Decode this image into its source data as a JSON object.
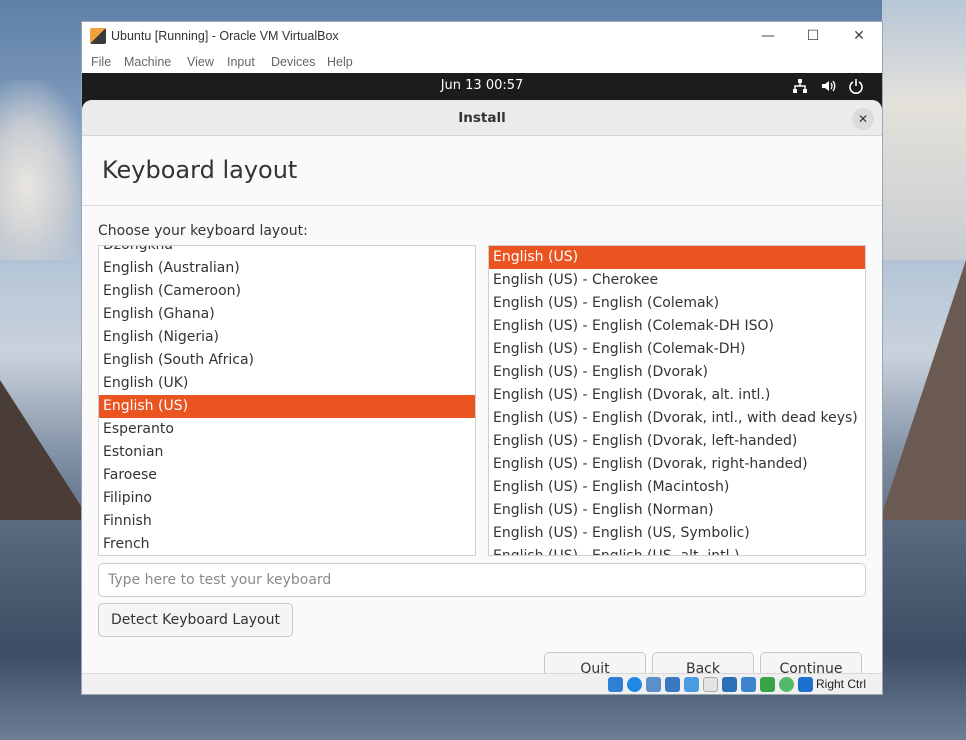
{
  "window": {
    "title": "Ubuntu [Running] - Oracle VM VirtualBox",
    "minimize": "—",
    "maximize": "☐",
    "close": "✕"
  },
  "menubar": [
    "File",
    "Machine",
    "View",
    "Input",
    "Devices",
    "Help"
  ],
  "topbar": {
    "clock": "Jun 13  00:57",
    "icons": [
      "network-icon",
      "volume-icon",
      "power-icon"
    ]
  },
  "dialog": {
    "title": "Install",
    "close": "✕",
    "heading": "Keyboard layout",
    "choose_label": "Choose your keyboard layout:",
    "accent_color": "#e95420"
  },
  "layouts": [
    "Dzongkha",
    "English (Australian)",
    "English (Cameroon)",
    "English (Ghana)",
    "English (Nigeria)",
    "English (South Africa)",
    "English (UK)",
    "English (US)",
    "Esperanto",
    "Estonian",
    "Faroese",
    "Filipino",
    "Finnish",
    "French"
  ],
  "selected_layout": "English (US)",
  "variants": [
    "English (US)",
    "English (US) - Cherokee",
    "English (US) - English (Colemak)",
    "English (US) - English (Colemak-DH ISO)",
    "English (US) - English (Colemak-DH)",
    "English (US) - English (Dvorak)",
    "English (US) - English (Dvorak, alt. intl.)",
    "English (US) - English (Dvorak, intl., with dead keys)",
    "English (US) - English (Dvorak, left-handed)",
    "English (US) - English (Dvorak, right-handed)",
    "English (US) - English (Macintosh)",
    "English (US) - English (Norman)",
    "English (US) - English (US, Symbolic)",
    "English (US) - English (US, alt. intl.)"
  ],
  "selected_variant": "English (US)",
  "test_input": {
    "placeholder": "Type here to test your keyboard",
    "value": ""
  },
  "buttons": {
    "detect": "Detect Keyboard Layout",
    "quit": "Quit",
    "back": "Back",
    "continue": "Continue"
  },
  "statusbar": {
    "host_key": "Right Ctrl",
    "icons": [
      "hard-disk-icon",
      "optical-drive-icon",
      "audio-icon",
      "network-adapter-icon",
      "usb-icon",
      "shared-folder-icon",
      "display-icon",
      "video-capture-icon",
      "cpu-icon",
      "mouse-integration-icon",
      "keyboard-capture-icon"
    ]
  }
}
